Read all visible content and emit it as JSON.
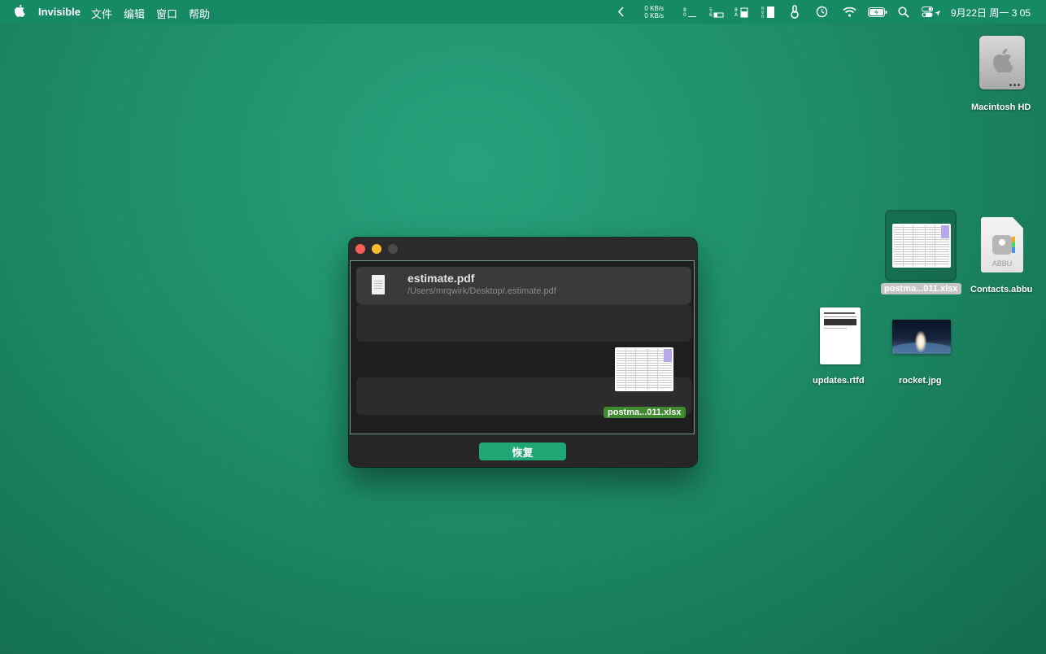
{
  "menubar": {
    "app_name": "Invisible",
    "items": [
      "文件",
      "编辑",
      "窗口",
      "帮助"
    ],
    "net_up": "0 KB/s",
    "net_down": "0 KB/s",
    "clock": "9月22日 周一  3 05"
  },
  "desktop": {
    "icons": [
      {
        "label": "Macintosh HD"
      },
      {
        "label": "postma...011.xlsx"
      },
      {
        "label": "Contacts.abbu",
        "badge_text": "ABBU"
      },
      {
        "label": "updates.rtfd"
      },
      {
        "label": "rocket.jpg"
      }
    ]
  },
  "window": {
    "files": [
      {
        "name": "estimate.pdf",
        "path": "/Users/mrqwirk/Desktop/.estimate.pdf"
      }
    ],
    "drag_label": "postma...011.xlsx",
    "restore_label": "恢复"
  },
  "colors": {
    "desktop": "#1f8f6a",
    "menubar": "#168a64",
    "accent_button": "#1fa876",
    "drag_label": "#3f8a2e"
  }
}
